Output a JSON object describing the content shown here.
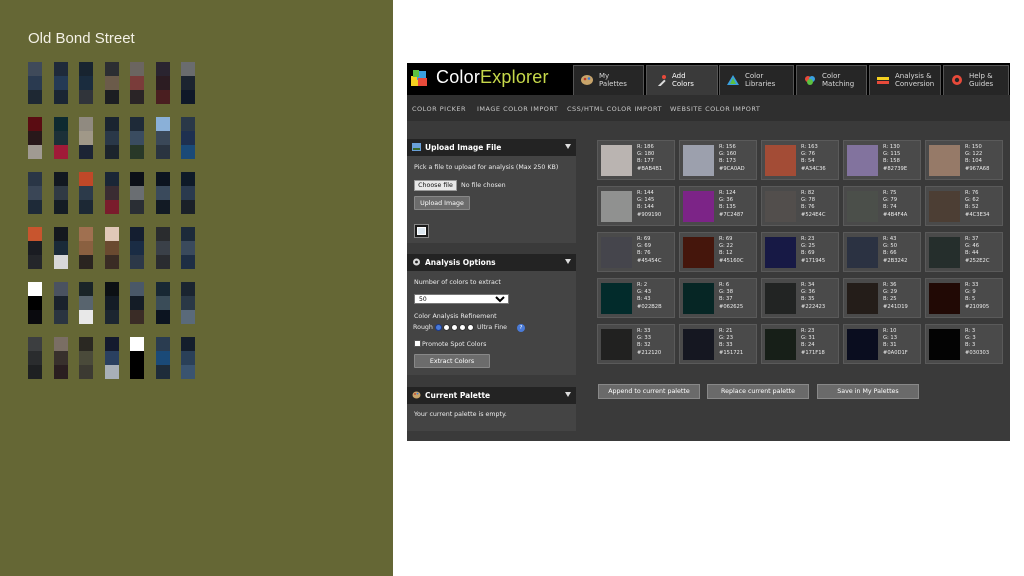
{
  "slide": {
    "title": "Old Bond Street",
    "background": "#656735",
    "swatch_rows": [
      [
        [
          "#3f4a5a",
          "#2a3a50",
          "#1e2833"
        ],
        [
          "#1f2a3a",
          "#243a55",
          "#1a2533"
        ],
        [
          "#182430",
          "#1a2c3e",
          "#30343a"
        ],
        [
          "#2c2e32",
          "#6b5b4a",
          "#1c1e22"
        ],
        [
          "#6b6560",
          "#7a3c3a",
          "#2a2426"
        ],
        [
          "#2a2430",
          "#2c1c22",
          "#4a1e20"
        ],
        [
          "#6a6c6e",
          "#1c2430",
          "#0f1828"
        ]
      ],
      [
        [
          "#5a0c12",
          "#28181a",
          "#a09a92"
        ],
        [
          "#0e2a30",
          "#1c3038",
          "#a01a38"
        ],
        [
          "#908a80",
          "#a09888",
          "#1c2434"
        ],
        [
          "#1a2430",
          "#2a3848",
          "#1c242c"
        ],
        [
          "#1e2a38",
          "#3a4c60",
          "#283828"
        ],
        [
          "#8ab0d8",
          "#3a4858",
          "#2a3440"
        ],
        [
          "#2a3848",
          "#1e3050",
          "#1a4a78"
        ]
      ],
      [
        [
          "#2a3646",
          "#3a4656",
          "#1e2a38"
        ],
        [
          "#121820",
          "#303a44",
          "#141c24"
        ],
        [
          "#c04828",
          "#2c3a4a",
          "#1c2834"
        ],
        [
          "#1a2636",
          "#3a2c32",
          "#7a1c2c"
        ],
        [
          "#0c1018",
          "#6a6e72",
          "#2a2e34"
        ],
        [
          "#0c1420",
          "#3a4a5c",
          "#121a24"
        ],
        [
          "#0e1a28",
          "#2a3a4e",
          "#1a2028"
        ]
      ],
      [
        [
          "#c8552e",
          "#1a1c22",
          "#24262a"
        ],
        [
          "#14181e",
          "#1a2a38",
          "#d8d8d8"
        ],
        [
          "#a07050",
          "#8a6040",
          "#2a2420"
        ],
        [
          "#e0c8b8",
          "#6a4a30",
          "#3a2c24"
        ],
        [
          "#141e30",
          "#1a2c44",
          "#2c3848"
        ],
        [
          "#2a2c2e",
          "#3a4048",
          "#2a2c30"
        ],
        [
          "#1c2a3a",
          "#3a4a5c",
          "#1e2e44"
        ]
      ],
      [
        [
          "#ffffff",
          "#000000",
          "#0a0a0e"
        ],
        [
          "#4a5260",
          "#1a222c",
          "#2a3440"
        ],
        [
          "#1a2428",
          "#58646e",
          "#e8e8e8"
        ],
        [
          "#0c1014",
          "#141c26",
          "#1c2630"
        ],
        [
          "#4a5868",
          "#141c26",
          "#3a2c26"
        ],
        [
          "#182834",
          "#3a4c58",
          "#0c1420"
        ],
        [
          "#1a2430",
          "#2a3846",
          "#5a6a7a"
        ]
      ],
      [
        [
          "#3c3e40",
          "#2a2c2e",
          "#1e2022"
        ],
        [
          "#7a6e64",
          "#38302c",
          "#2a1e20"
        ],
        [
          "#2a2822",
          "#4a4a3a",
          "#3c3a32"
        ],
        [
          "#141a2e",
          "#2a4060",
          "#a8b0b8"
        ],
        [
          "#ffffff",
          "#000000",
          "#000000"
        ],
        [
          "#2a3c50",
          "#1a4a78",
          "#1e2c3a"
        ],
        [
          "#141e2c",
          "#2a4058",
          "#3a5470"
        ]
      ]
    ]
  },
  "app": {
    "logo_text_a": "Color",
    "logo_text_b": "Explorer",
    "tabs": [
      {
        "line1": "My",
        "line2": "Palettes",
        "icon": "palette-icon",
        "active": false
      },
      {
        "line1": "Add",
        "line2": "Colors",
        "icon": "eyedropper-icon",
        "active": true
      },
      {
        "line1": "Color",
        "line2": "Libraries",
        "icon": "libraries-icon",
        "active": false
      },
      {
        "line1": "Color",
        "line2": "Matching",
        "icon": "matching-icon",
        "active": false
      },
      {
        "line1": "Analysis &",
        "line2": "Conversion",
        "icon": "analysis-icon",
        "active": false
      },
      {
        "line1": "Help &",
        "line2": "Guides",
        "icon": "lifebuoy-icon",
        "active": false
      }
    ],
    "subnav": [
      "COLOR PICKER",
      "IMAGE COLOR IMPORT",
      "CSS/HTML COLOR IMPORT",
      "WEBSITE COLOR IMPORT"
    ],
    "upload_panel": {
      "title": "Upload Image File",
      "instructions": "Pick a file to upload for analysis (Max 250 KB)",
      "choose_label": "Choose file",
      "no_file": "No file chosen",
      "upload_button": "Upload Image"
    },
    "analysis_panel": {
      "title": "Analysis Options",
      "num_colors_label": "Number of colors to extract",
      "num_colors_value": "50",
      "refinement_label": "Color Analysis Refinement",
      "rough": "Rough",
      "ultra": "Ultra Fine",
      "promote_label": "Promote Spot Colors",
      "extract_button": "Extract Colors"
    },
    "palette_panel": {
      "title": "Current Palette",
      "empty_text": "Your current palette is empty."
    },
    "colors": [
      {
        "hex": "#BAB4B1",
        "r": "186",
        "g": "180",
        "b": "177"
      },
      {
        "hex": "#9CA0AD",
        "r": "156",
        "g": "160",
        "b": "173"
      },
      {
        "hex": "#A34C36",
        "r": "163",
        "g": "76",
        "b": "54"
      },
      {
        "hex": "#82739E",
        "r": "130",
        "g": "115",
        "b": "158"
      },
      {
        "hex": "#967A68",
        "r": "150",
        "g": "122",
        "b": "104"
      },
      {
        "hex": "#909190",
        "r": "144",
        "g": "145",
        "b": "144"
      },
      {
        "hex": "#7C2487",
        "r": "124",
        "g": "36",
        "b": "135"
      },
      {
        "hex": "#524E4C",
        "r": "82",
        "g": "78",
        "b": "76"
      },
      {
        "hex": "#4B4F4A",
        "r": "75",
        "g": "79",
        "b": "74"
      },
      {
        "hex": "#4C3E34",
        "r": "76",
        "g": "62",
        "b": "52"
      },
      {
        "hex": "#45454C",
        "r": "69",
        "g": "69",
        "b": "76"
      },
      {
        "hex": "#45160C",
        "r": "69",
        "g": "22",
        "b": "12"
      },
      {
        "hex": "#171945",
        "r": "23",
        "g": "25",
        "b": "69"
      },
      {
        "hex": "#2B3242",
        "r": "43",
        "g": "50",
        "b": "66"
      },
      {
        "hex": "#252E2C",
        "r": "37",
        "g": "46",
        "b": "44"
      },
      {
        "hex": "#022B2B",
        "r": "2",
        "g": "43",
        "b": "43"
      },
      {
        "hex": "#062625",
        "r": "6",
        "g": "38",
        "b": "37"
      },
      {
        "hex": "#222423",
        "r": "34",
        "g": "36",
        "b": "35"
      },
      {
        "hex": "#241D19",
        "r": "36",
        "g": "29",
        "b": "25"
      },
      {
        "hex": "#210905",
        "r": "33",
        "g": "9",
        "b": "5"
      },
      {
        "hex": "#212120",
        "r": "33",
        "g": "33",
        "b": "32"
      },
      {
        "hex": "#151721",
        "r": "21",
        "g": "23",
        "b": "33"
      },
      {
        "hex": "#171F18",
        "r": "23",
        "g": "31",
        "b": "24"
      },
      {
        "hex": "#0A0D1F",
        "r": "10",
        "g": "13",
        "b": "31"
      },
      {
        "hex": "#030303",
        "r": "3",
        "g": "3",
        "b": "3"
      }
    ],
    "actions": [
      "Append to current palette",
      "Replace current palette",
      "Save in My Palettes"
    ]
  }
}
